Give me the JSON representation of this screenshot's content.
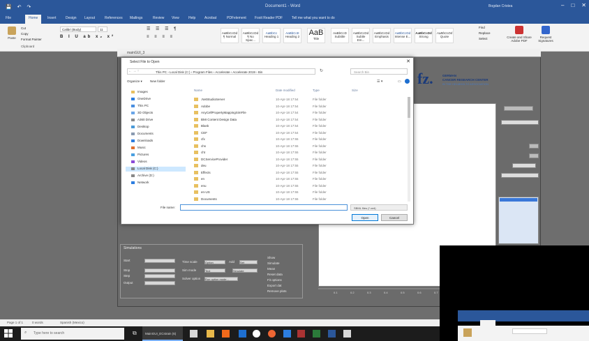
{
  "word": {
    "title": "Document1 - Word",
    "user": "Bogdan Cristea",
    "tabs": [
      "File",
      "Home",
      "Insert",
      "Design",
      "Layout",
      "References",
      "Mailings",
      "Review",
      "View",
      "Help",
      "Acrobat",
      "PDFelement",
      "Foxit Reader PDF"
    ],
    "active_tab": "Home",
    "tell_me": "Tell me what you want to do",
    "clipboard": {
      "paste": "Paste",
      "cut": "Cut",
      "copy": "Copy",
      "format_painter": "Format Painter",
      "group": "Clipboard"
    },
    "font_name": "Calibri (Body)",
    "font_size": "11",
    "styles": [
      {
        "sample": "AaBbCcDd",
        "name": "¶ Normal"
      },
      {
        "sample": "AaBbCcDd",
        "name": "¶ No Spac..."
      },
      {
        "sample": "AaBbCc",
        "name": "Heading 1"
      },
      {
        "sample": "AaBbCcE",
        "name": "Heading 2"
      },
      {
        "sample": "AaB",
        "name": "Title"
      },
      {
        "sample": "AaBbCcD",
        "name": "Subtitle"
      },
      {
        "sample": "AaBbCcDd",
        "name": "Subtle Em..."
      },
      {
        "sample": "AaBbCcDd",
        "name": "Emphasis"
      },
      {
        "sample": "AaBbCcDd",
        "name": "Intense E..."
      },
      {
        "sample": "AaBbCcDd",
        "name": "Strong"
      },
      {
        "sample": "AaBbCcDd",
        "name": "Quote"
      }
    ],
    "editing": {
      "find": "Find",
      "replace": "Replace",
      "select": "Select"
    },
    "acrobat": {
      "create": "Create and Share Adobe PDF",
      "request": "Request Signatures"
    },
    "status": {
      "page": "Page 1 of 1",
      "words": "0 words",
      "lang": "Spanish (Mexico)"
    },
    "taskbar_search": "Type here to search",
    "taskbar_app": "MainGUI_ECstrain (6)"
  },
  "app": {
    "title": "mainGUI_3",
    "logo_fz": "fz.",
    "logo_l1": "GERMAN",
    "logo_l2": "CANCER RESEARCH CENTER",
    "logo_l3": "IN THE HELMHOLTZ ASSOCIATION",
    "simulations_header": "Simulations",
    "sim_fields": [
      "Start",
      "Stop",
      "Step",
      "Output"
    ],
    "sim_dropdowns": [
      "Option",
      "Text",
      "Run option mode..."
    ],
    "sim_labels": [
      "Time scale",
      "Add",
      "Sim mode",
      "Solver option"
    ],
    "sim_buttons": [
      "Set",
      "Simulate"
    ],
    "sim_checks": [
      "Show",
      "Simulate",
      "Mean",
      "Reset data",
      "Fit options",
      "Export dat",
      "Remove plots"
    ]
  },
  "dialog": {
    "title": "Select File to Open",
    "address": [
      "This PC",
      "Local Disk (C:)",
      "Program Files",
      "Accelerate",
      "Accelerate 2019",
      "Bin"
    ],
    "search_placeholder": "Search Bin",
    "organize": "Organize ▾",
    "new_folder": "New folder",
    "nav": [
      {
        "label": "Images",
        "icon": "folder-icon"
      },
      {
        "label": "OneDrive",
        "icon": "cloud-icon"
      },
      {
        "label": "This PC",
        "icon": "computer-icon"
      },
      {
        "label": "3D Objects",
        "icon": "cube-icon"
      },
      {
        "label": "A360 Drive",
        "icon": "drive-icon"
      },
      {
        "label": "Desktop",
        "icon": "desktop-icon"
      },
      {
        "label": "Documents",
        "icon": "document-icon"
      },
      {
        "label": "Downloads",
        "icon": "download-icon"
      },
      {
        "label": "Music",
        "icon": "music-icon"
      },
      {
        "label": "Pictures",
        "icon": "picture-icon"
      },
      {
        "label": "Videos",
        "icon": "video-icon"
      },
      {
        "label": "Local Disk (C:)",
        "icon": "disk-icon"
      },
      {
        "label": "Archive (D:)",
        "icon": "disk-icon"
      },
      {
        "label": "Network",
        "icon": "network-icon"
      }
    ],
    "selected_nav": 11,
    "columns": [
      "Name",
      "Date modified",
      "Type",
      "Size"
    ],
    "files": [
      {
        "name": ".NetStudioServer",
        "date": "10-Apr-18 17:54",
        "type": "File folder"
      },
      {
        "name": "Adobe",
        "date": "10-Apr-18 17:54",
        "type": "File folder"
      },
      {
        "name": "AnyCellPropertyMappingSimFile",
        "date": "10-Apr-18 17:54",
        "type": "File folder"
      },
      {
        "name": "BMI Content Design Data",
        "date": "10-Apr-18 17:54",
        "type": "File folder"
      },
      {
        "name": "Blank",
        "date": "10-Apr-18 17:54",
        "type": "File folder"
      },
      {
        "name": "CEF",
        "date": "10-Apr-18 17:54",
        "type": "File folder"
      },
      {
        "name": "cfx",
        "date": "10-Apr-18 17:55",
        "type": "File folder"
      },
      {
        "name": "chs",
        "date": "10-Apr-18 17:55",
        "type": "File folder"
      },
      {
        "name": "cht",
        "date": "10-Apr-18 17:55",
        "type": "File folder"
      },
      {
        "name": "DCServiceProvider",
        "date": "10-Apr-18 17:55",
        "type": "File folder"
      },
      {
        "name": "deu",
        "date": "10-Apr-18 17:55",
        "type": "File folder"
      },
      {
        "name": "Effects",
        "date": "10-Apr-18 17:55",
        "type": "File folder"
      },
      {
        "name": "en",
        "date": "10-Apr-18 17:55",
        "type": "File folder"
      },
      {
        "name": "enu",
        "date": "10-Apr-18 17:55",
        "type": "File folder"
      },
      {
        "name": "en-US",
        "date": "10-Apr-18 17:55",
        "type": "File folder"
      },
      {
        "name": "Documents",
        "date": "10-Apr-18 17:55",
        "type": "File folder"
      }
    ],
    "filename_label": "File name:",
    "filetype": "SBML files (*.xml)",
    "open": "Open",
    "cancel": "Cancel"
  }
}
